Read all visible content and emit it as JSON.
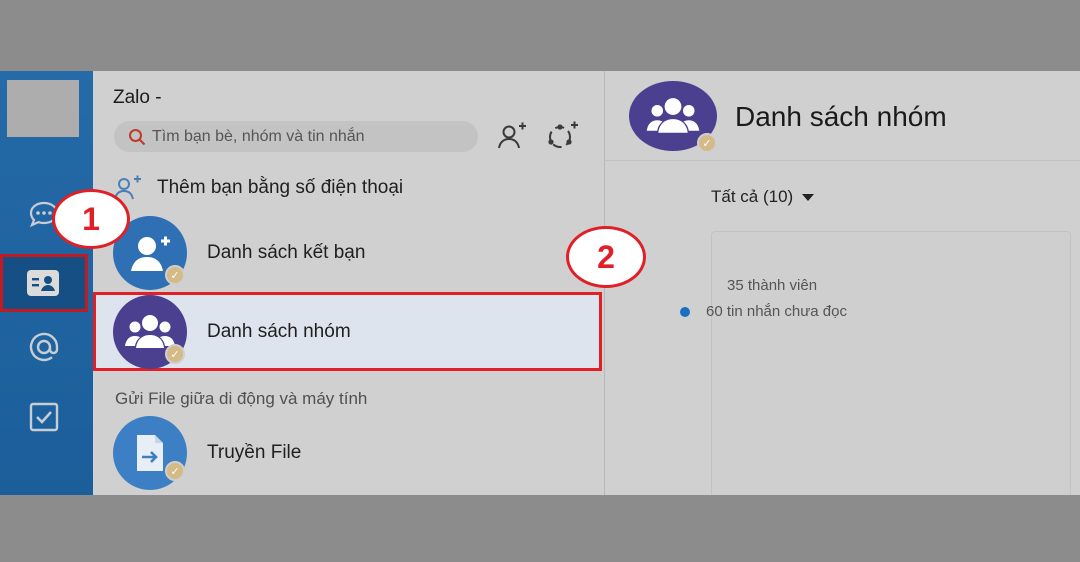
{
  "app": {
    "title": "Zalo -"
  },
  "search": {
    "placeholder": "Tìm bạn bè, nhóm và tin nhắn"
  },
  "contacts": {
    "add_by_phone": "Thêm bạn bằng số điện thoại",
    "friends_list": "Danh sách kết bạn",
    "groups_list": "Danh sách nhóm",
    "section_file": "Gửi File giữa di động và máy tính",
    "transfer_file": "Truyền File"
  },
  "right": {
    "title": "Danh sách nhóm",
    "filter": "Tất cả (10)",
    "members": "35 thành viên",
    "unread": "60 tin nhắn chưa đọc"
  },
  "callouts": {
    "one": "1",
    "two": "2"
  },
  "colors": {
    "nav_blue": "#2a7cc3",
    "highlight_red": "#e01f26",
    "group_purple": "#4b3f8f",
    "friend_blue": "#2f6fb4"
  },
  "icons": [
    "chat-icon",
    "contacts-icon",
    "at-icon",
    "todo-icon",
    "search-icon",
    "add-friend-icon",
    "create-group-icon",
    "group-icon",
    "file-transfer-icon",
    "verified-badge-icon"
  ]
}
